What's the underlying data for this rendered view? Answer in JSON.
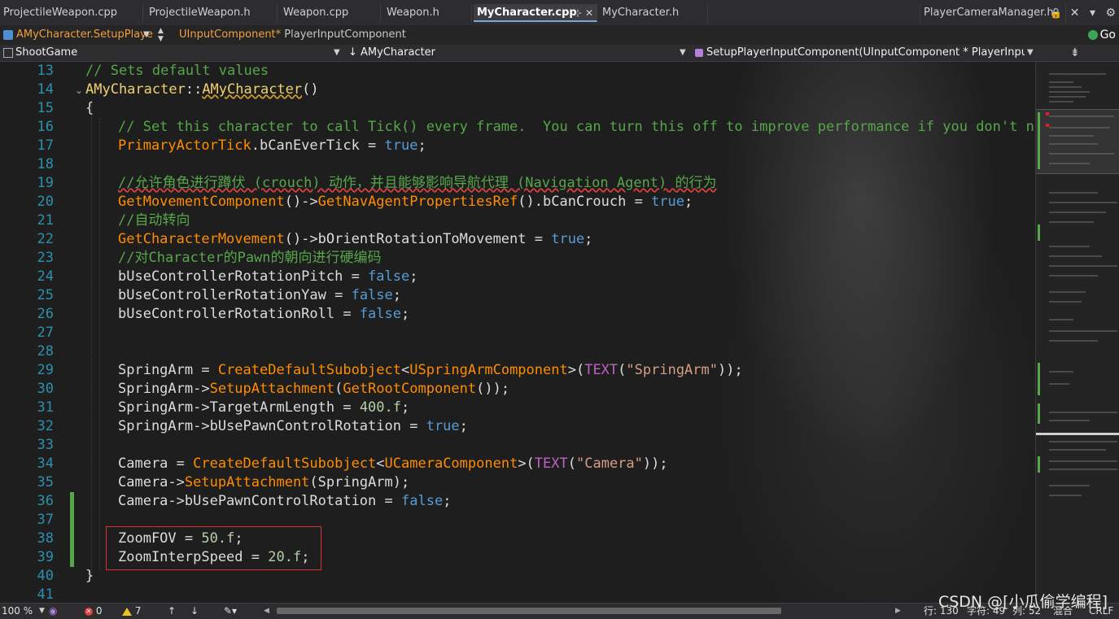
{
  "tabs": [
    {
      "label": "ProjectileWeapon.cpp"
    },
    {
      "label": "ProjectileWeapon.h"
    },
    {
      "label": "Weapon.cpp"
    },
    {
      "label": "Weapon.h"
    },
    {
      "label": "MyCharacter.cpp",
      "active": true
    },
    {
      "label": "MyCharacter.h"
    },
    {
      "label": "PlayerCameraManager.h"
    }
  ],
  "nav": {
    "scope": "AMyCharacter.SetupPlaye",
    "param_type": "UInputComponent*",
    "param_name": "PlayerInputComponent",
    "go_label": "Go"
  },
  "combos": {
    "project": "ShootGame",
    "class": "↓ AMyCharacter",
    "member": "SetupPlayerInputComponent(UInputComponent * PlayerInputComp"
  },
  "line_numbers": [
    "13",
    "14",
    "15",
    "16",
    "17",
    "18",
    "19",
    "20",
    "21",
    "22",
    "23",
    "24",
    "25",
    "26",
    "27",
    "28",
    "29",
    "30",
    "31",
    "32",
    "33",
    "34",
    "35",
    "36",
    "37",
    "38",
    "39",
    "40",
    "41"
  ],
  "code": {
    "l13": "// Sets default values",
    "l14_class": "AMyCharacter",
    "l14_sep": "::",
    "l14_ctor": "AMyCharacter",
    "l14_paren": "()",
    "l15": "{",
    "l16": "// Set this character to call Tick() every frame.  You can turn this off to improve performance if you don't need it.",
    "l17_a": "PrimaryActorTick",
    "l17_b": ".bCanEverTick = ",
    "l17_c": "true",
    "l17_d": ";",
    "l19": "//允许角色进行蹲伏 (crouch) 动作，并且能够影响导航代理 (Navigation Agent) 的行为",
    "l20_a": "GetMovementComponent",
    "l20_b": "()->",
    "l20_c": "GetNavAgentPropertiesRef",
    "l20_d": "().bCanCrouch = ",
    "l20_e": "true",
    "l20_f": ";",
    "l21": "//自动转向",
    "l22_a": "GetCharacterMovement",
    "l22_b": "()->bOrientRotationToMovement = ",
    "l22_c": "true",
    "l22_d": ";",
    "l23": "//对Character的Pawn的朝向进行硬编码",
    "l24_a": "bUseControllerRotationPitch = ",
    "l24_b": "false",
    "l24_c": ";",
    "l25_a": "bUseControllerRotationYaw = ",
    "l25_b": "false",
    "l25_c": ";",
    "l26_a": "bUseControllerRotationRoll = ",
    "l26_b": "false",
    "l26_c": ";",
    "l29_a": "SpringArm = ",
    "l29_b": "CreateDefaultSubobject",
    "l29_c": "<",
    "l29_d": "USpringArmComponent",
    "l29_e": ">(",
    "l29_f": "TEXT",
    "l29_g": "(",
    "l29_h": "\"SpringArm\"",
    "l29_i": "));",
    "l30_a": "SpringArm->",
    "l30_b": "SetupAttachment",
    "l30_c": "(",
    "l30_d": "GetRootComponent",
    "l30_e": "());",
    "l31_a": "SpringArm->TargetArmLength = ",
    "l31_b": "400.f",
    "l31_c": ";",
    "l32_a": "SpringArm->bUsePawnControlRotation = ",
    "l32_b": "true",
    "l32_c": ";",
    "l34_a": "Camera = ",
    "l34_b": "CreateDefaultSubobject",
    "l34_c": "<",
    "l34_d": "UCameraComponent",
    "l34_e": ">(",
    "l34_f": "TEXT",
    "l34_g": "(",
    "l34_h": "\"Camera\"",
    "l34_i": "));",
    "l35_a": "Camera->",
    "l35_b": "SetupAttachment",
    "l35_c": "(SpringArm);",
    "l36_a": "Camera->bUsePawnControlRotation = ",
    "l36_b": "false",
    "l36_c": ";",
    "l38_a": "ZoomFOV = ",
    "l38_b": "50.f",
    "l38_c": ";",
    "l39_a": "ZoomInterpSpeed = ",
    "l39_b": "20.f",
    "l39_c": ";",
    "l40": "}"
  },
  "status": {
    "zoom": "100 %",
    "errors": "0",
    "warnings": "7",
    "line": "行: 130",
    "char": "字符: 49",
    "col": "列: 52",
    "mode": "混合",
    "eol": "CRLF"
  },
  "watermark": "CSDN @[小瓜偷学编程]",
  "colors": {
    "comment": "#57a64a",
    "function": "#ff8c00",
    "keyword": "#569cd6",
    "string": "#d69d85",
    "macro": "#bd63c5",
    "line_number": "#2b91af",
    "highlight_box": "#e03030"
  }
}
